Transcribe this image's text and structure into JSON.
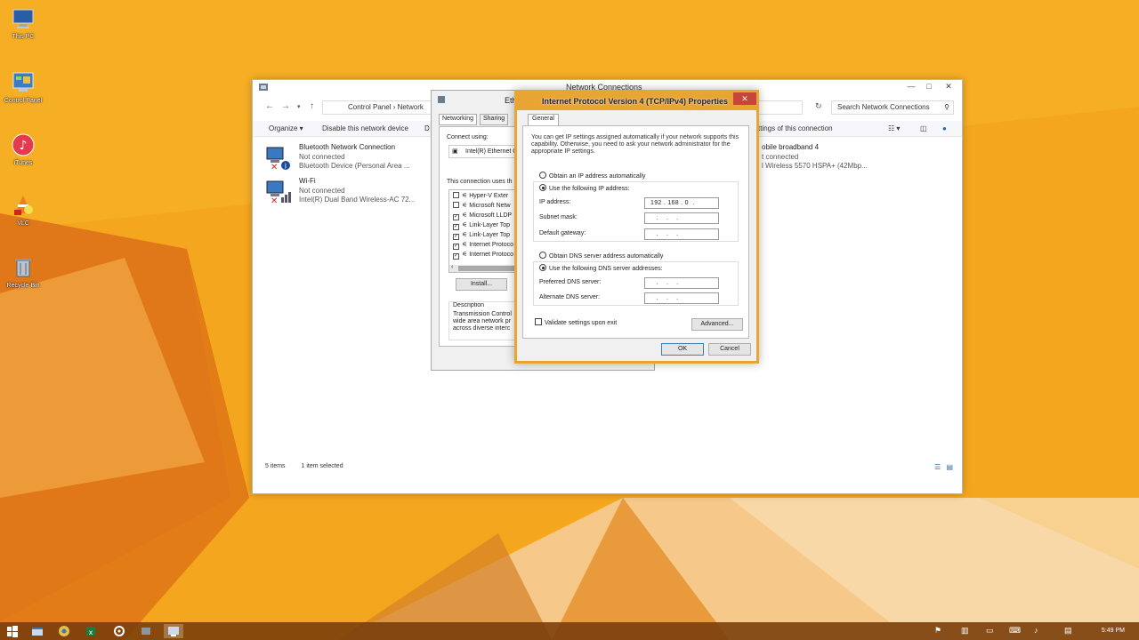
{
  "desktop": {
    "icons": [
      {
        "label": "This PC",
        "icon": "computer-icon"
      },
      {
        "label": "Control Panel",
        "icon": "control-panel-icon"
      },
      {
        "label": "iTunes",
        "icon": "itunes-icon"
      },
      {
        "label": "VLC",
        "icon": "vlc-icon"
      },
      {
        "label": "Recycle Bin",
        "icon": "recycle-bin-icon"
      }
    ]
  },
  "network_window": {
    "title": "Network Connections",
    "breadcrumb": "Control Panel  ›  Network",
    "search_placeholder": "Search Network Connections",
    "toolbar": {
      "organize": "Organize ▾",
      "disable": "Disable this network device",
      "d_partial": "D",
      "settings_partial": "ttings of this connection"
    },
    "connections": [
      {
        "name": "Bluetooth Network Connection",
        "status": "Not connected",
        "device": "Bluetooth Device (Personal Area ..."
      },
      {
        "name": "Wi-Fi",
        "status": "Not connected",
        "device": "Intel(R) Dual Band Wireless-AC 72..."
      },
      {
        "name": "obile broadband 4",
        "status": "t connected",
        "device": "l Wireless 5570 HSPA+ (42Mbp..."
      }
    ],
    "status_items": "5 items",
    "status_selected": "1 item selected"
  },
  "ethernet_window": {
    "title_partial": "Eth",
    "tabs": [
      "Networking",
      "Sharing"
    ],
    "connect_using_label": "Connect using:",
    "adapter": "Intel(R) Ethernet C",
    "uses_label": "This connection uses th",
    "items": [
      {
        "label": "Hyper-V Exter",
        "checked": false
      },
      {
        "label": "Microsoft Netw",
        "checked": false
      },
      {
        "label": "Microsoft LLDP",
        "checked": true
      },
      {
        "label": "Link-Layer Top",
        "checked": true
      },
      {
        "label": "Link-Layer Top",
        "checked": true
      },
      {
        "label": "Internet Protoco",
        "checked": true
      },
      {
        "label": "Internet Protoco",
        "checked": true
      }
    ],
    "install_button": "Install...",
    "description_label": "Description",
    "description_text": "Transmission Control wide area network pr across diverse interc"
  },
  "ipv4_dialog": {
    "title": "Internet Protocol Version 4 (TCP/IPv4) Properties",
    "close_glyph": "✕",
    "tab": "General",
    "intro": "You can get IP settings assigned automatically if your network supports this capability. Otherwise, you need to ask your network administrator for the appropriate IP settings.",
    "obtain_ip_auto": "Obtain an IP address automatically",
    "use_following_ip": "Use the following IP address:",
    "ip_address_label": "IP address:",
    "ip_address_value": "192 . 168 . 0  .",
    "subnet_mask_label": "Subnet mask:",
    "subnet_mask_value": "   .    .    .",
    "default_gateway_label": "Default gateway:",
    "default_gateway_value": "   .    .    .",
    "obtain_dns_auto": "Obtain DNS server address automatically",
    "use_following_dns": "Use the following DNS server addresses:",
    "preferred_dns_label": "Preferred DNS server:",
    "preferred_dns_value": "   .    .    .",
    "alternate_dns_label": "Alternate DNS server:",
    "alternate_dns_value": "   .    .    .",
    "validate_label": "Validate settings upon exit",
    "advanced_button": "Advanced...",
    "ok_button": "OK",
    "cancel_button": "Cancel",
    "ip_mode": "manual",
    "dns_mode": "manual"
  },
  "taskbar": {
    "clock": "5:49 PM"
  },
  "colors": {
    "accent": "#e8a533",
    "close": "#c7453b",
    "wallpaper": "#f2a51c"
  }
}
